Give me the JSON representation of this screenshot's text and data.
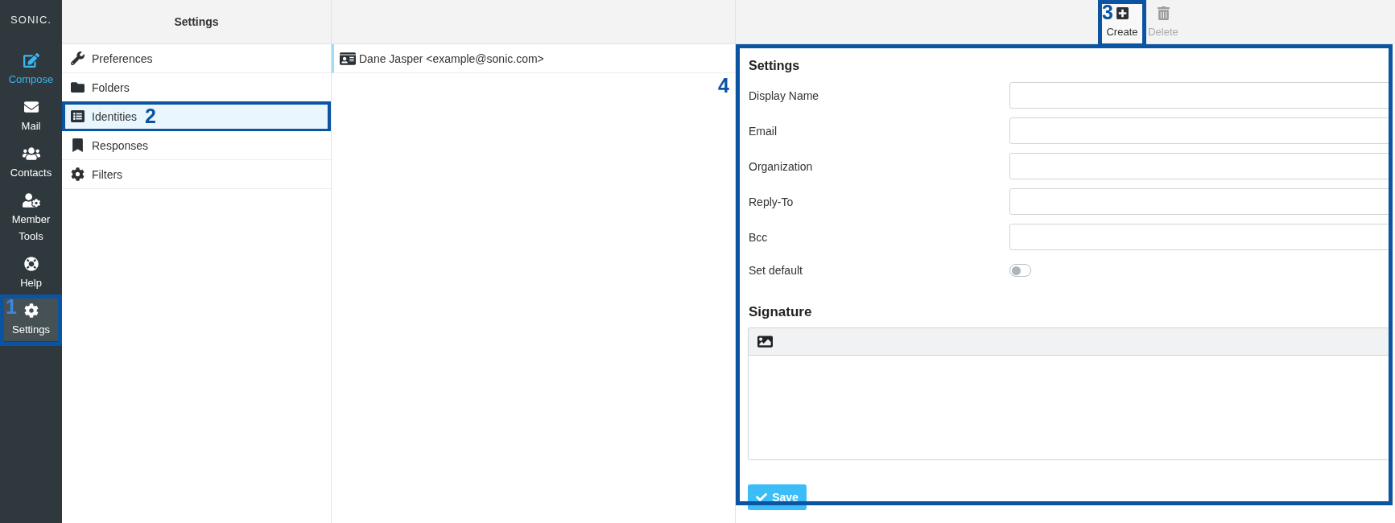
{
  "nav": {
    "logo": "SONIC.",
    "items": [
      {
        "label": "Compose",
        "kind": "action",
        "selected": false
      },
      {
        "label": "Mail",
        "kind": "link",
        "selected": false
      },
      {
        "label": "Contacts",
        "kind": "link",
        "selected": false
      },
      {
        "label": "Member Tools",
        "kind": "link",
        "selected": false
      },
      {
        "label": "Help",
        "kind": "link",
        "selected": false
      },
      {
        "label": "Settings",
        "kind": "link",
        "selected": true,
        "callout": "1"
      }
    ]
  },
  "settings_panel": {
    "title": "Settings",
    "items": [
      {
        "label": "Preferences",
        "selected": false
      },
      {
        "label": "Folders",
        "selected": false
      },
      {
        "label": "Identities",
        "selected": true,
        "callout": "2"
      },
      {
        "label": "Responses",
        "selected": false
      },
      {
        "label": "Filters",
        "selected": false
      }
    ]
  },
  "identities": {
    "items": [
      {
        "label": "Dane Jasper <example@sonic.com>",
        "selected": true
      }
    ]
  },
  "toolbar": {
    "buttons": [
      {
        "label": "Create",
        "disabled": false,
        "callout": "3"
      },
      {
        "label": "Delete",
        "disabled": true
      }
    ]
  },
  "form": {
    "callout": "4",
    "title": "Settings",
    "fields": [
      {
        "kind": "text",
        "label": "Display Name"
      },
      {
        "kind": "text",
        "label": "Email"
      },
      {
        "kind": "text",
        "label": "Organization"
      },
      {
        "kind": "text",
        "label": "Reply-To"
      },
      {
        "kind": "text",
        "label": "Bcc"
      },
      {
        "kind": "toggle",
        "label": "Set default",
        "on": false
      }
    ],
    "signature": {
      "title": "Signature"
    },
    "save_button": "Save"
  }
}
